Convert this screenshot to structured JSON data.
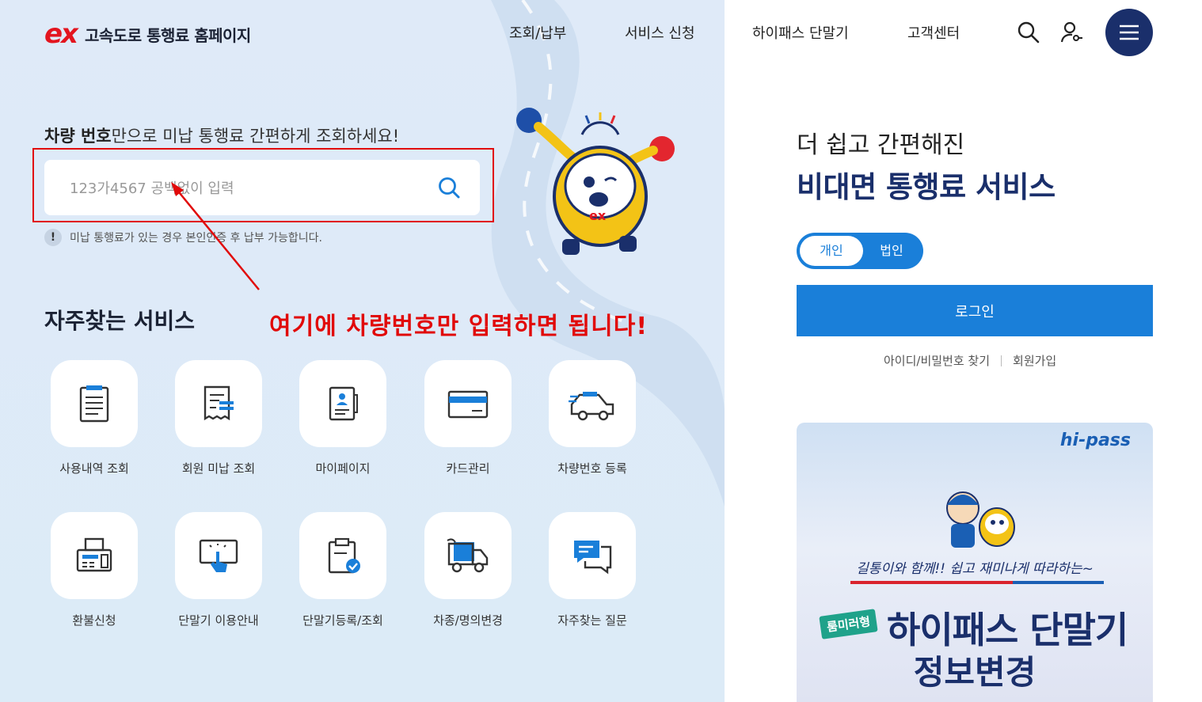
{
  "header": {
    "logo_mark": "ex",
    "logo_text": "고속도로 통행료 홈페이지",
    "nav": [
      "조회/납부",
      "서비스 신청",
      "하이패스 단말기",
      "고객센터"
    ]
  },
  "search": {
    "heading_bold": "차량 번호",
    "heading_rest": "만으로 미납 통행료 간편하게 조회하세요!",
    "placeholder": "123가4567 공백없이 입력",
    "notice": "미납 통행료가 있는 경우 본인인증 후 납부 가능합니다.",
    "notice_icon": "!"
  },
  "annotation": "여기에 차량번호만 입력하면 됩니다!",
  "mascot": {
    "badge": "ex"
  },
  "services": {
    "title": "자주찾는 서비스",
    "items": [
      {
        "label": "사용내역 조회",
        "icon": "document-list-icon"
      },
      {
        "label": "회원 미납 조회",
        "icon": "receipt-icon"
      },
      {
        "label": "마이페이지",
        "icon": "profile-book-icon"
      },
      {
        "label": "카드관리",
        "icon": "card-icon"
      },
      {
        "label": "차량번호 등록",
        "icon": "car-icon"
      },
      {
        "label": "환불신청",
        "icon": "fax-icon"
      },
      {
        "label": "단말기 이용안내",
        "icon": "touch-screen-icon"
      },
      {
        "label": "단말기등록/조회",
        "icon": "clipboard-check-icon"
      },
      {
        "label": "차종/명의변경",
        "icon": "truck-icon"
      },
      {
        "label": "자주찾는 질문",
        "icon": "chat-bubble-icon"
      }
    ]
  },
  "right": {
    "subtitle": "더 쉽고 간편해진",
    "title": "비대면 통행료 서비스",
    "toggle": {
      "personal": "개인",
      "corporate": "법인",
      "active": "personal"
    },
    "login_label": "로그인",
    "links": {
      "find": "아이디/비밀번호 찾기",
      "join": "회원가입"
    },
    "banner": {
      "brand": "hi-pass",
      "slogan": "길통이와 함께!! 쉽고 재미나게 따라하는~",
      "tag": "룸미러형",
      "title": "하이패스 단말기",
      "title2": "정보변경"
    }
  },
  "colors": {
    "brand_red": "#e3151f",
    "navy": "#1a2f6b",
    "primary_blue": "#1a7fd9",
    "annotation_red": "#e10a0a"
  }
}
